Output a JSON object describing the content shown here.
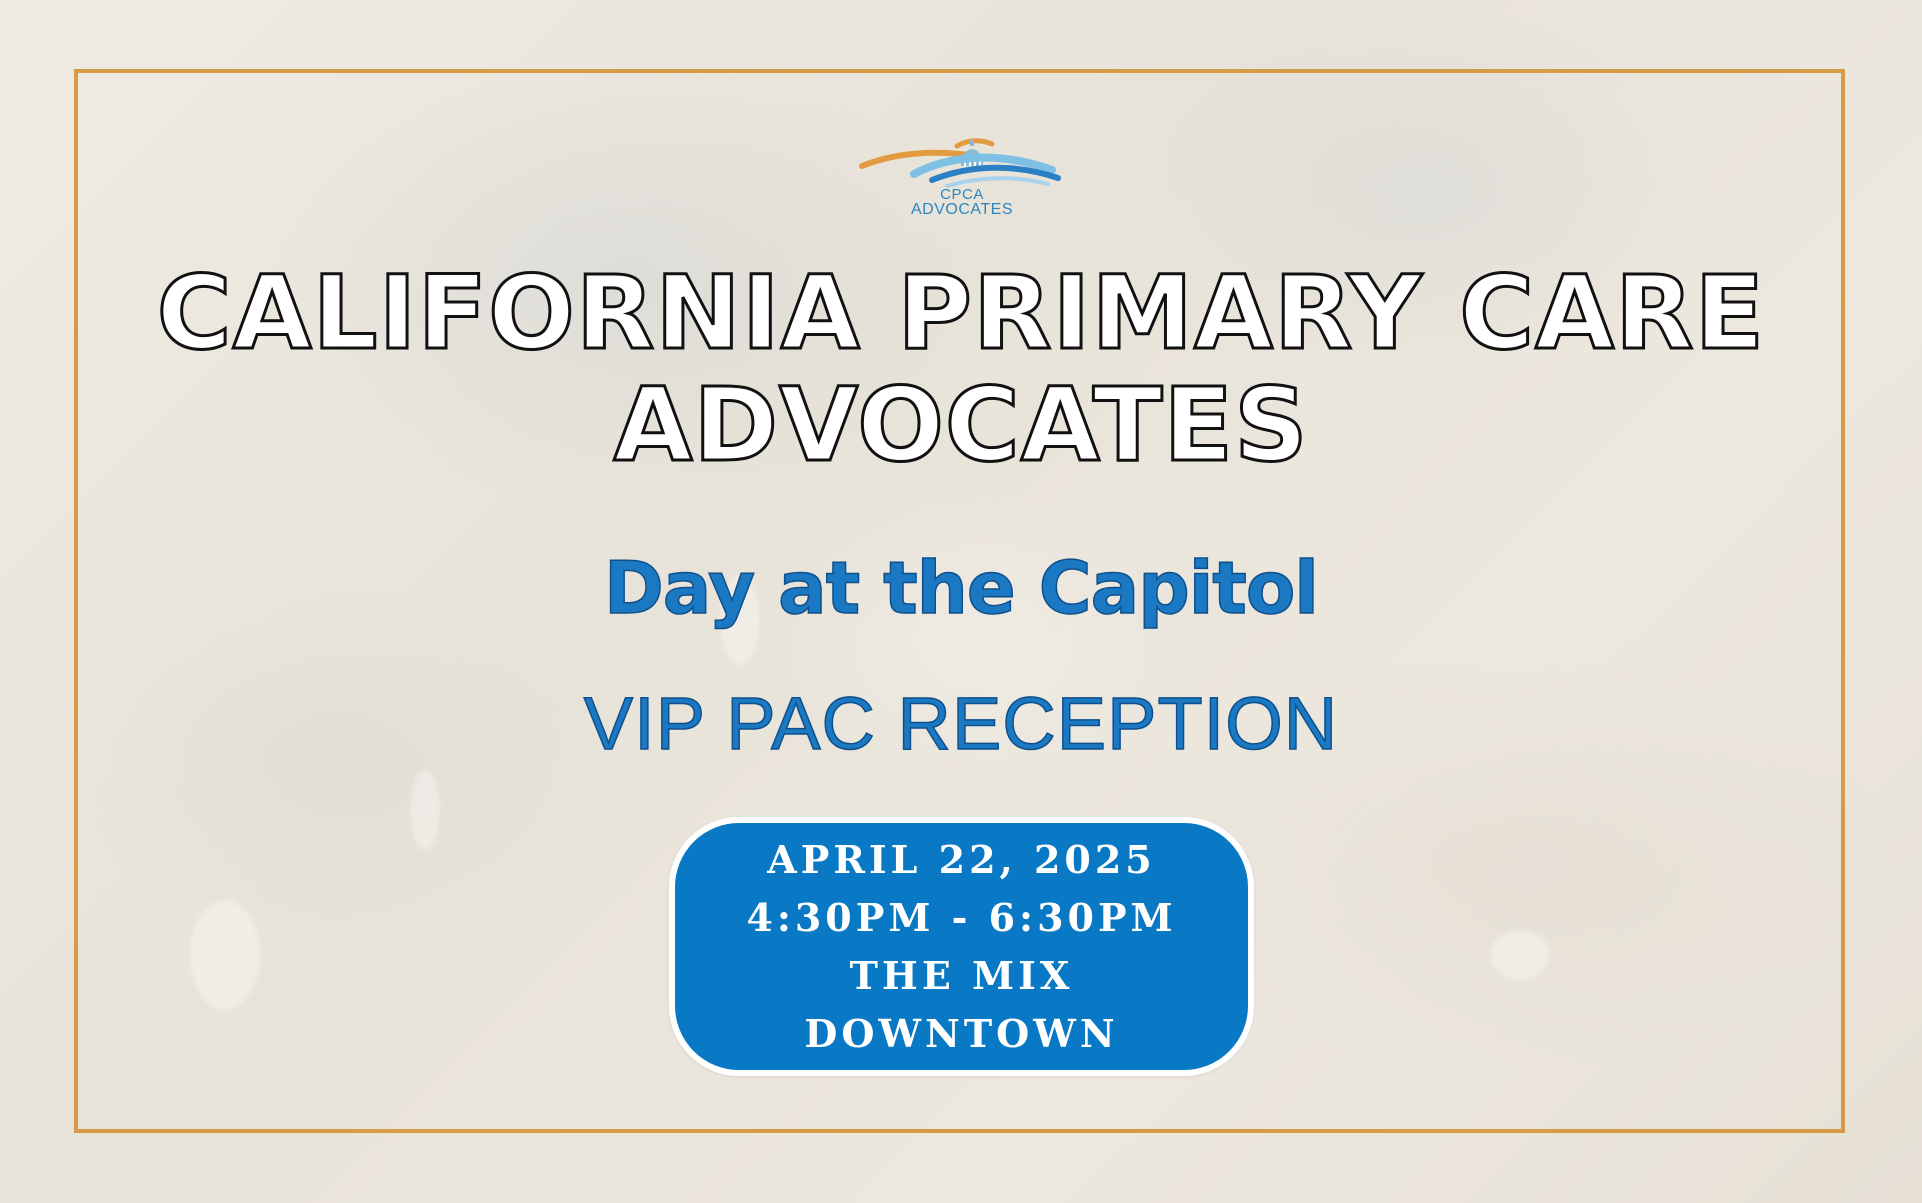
{
  "logo": {
    "line1": "CPCA",
    "line2": "ADVOCATES",
    "icon": "capitol-dome-waves-logo"
  },
  "title": {
    "line1": "CALIFORNIA PRIMARY CARE",
    "line2": "ADVOCATES"
  },
  "subtitle": "Day at the Capitol",
  "reception": "VIP PAC RECEPTION",
  "details": {
    "date": "APRIL 22, 2025",
    "time": "4:30PM - 6:30PM",
    "venue_line1": "THE MIX",
    "venue_line2": "DOWNTOWN"
  },
  "colors": {
    "frame": "#d79b45",
    "accent_blue": "#1b78c3",
    "card_blue": "#0a79c5",
    "background": "#ebe6dc"
  }
}
